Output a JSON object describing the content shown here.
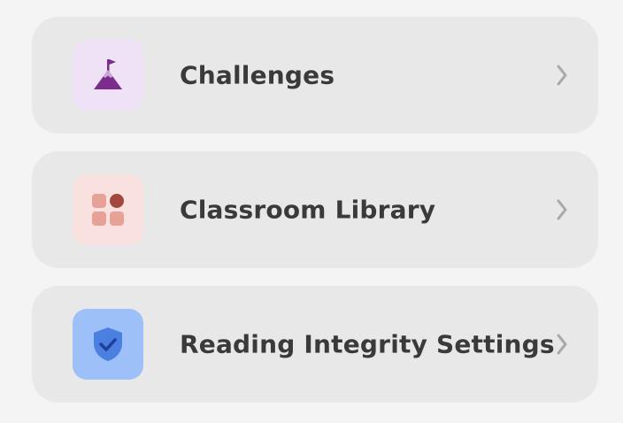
{
  "menu": {
    "items": [
      {
        "label": "Challenges",
        "icon": "mountain-flag-icon",
        "tile_color": "#f0e2f6",
        "icon_color": "#7b2d8e"
      },
      {
        "label": "Classroom Library",
        "icon": "grid-dots-icon",
        "tile_color": "#f9e1df",
        "icon_color": "#e8a197"
      },
      {
        "label": "Reading Integrity Settings",
        "icon": "shield-check-icon",
        "tile_color": "#9cc0f7",
        "icon_color": "#4b7fe0"
      }
    ],
    "chevron_icon": "chevron-right-icon"
  }
}
